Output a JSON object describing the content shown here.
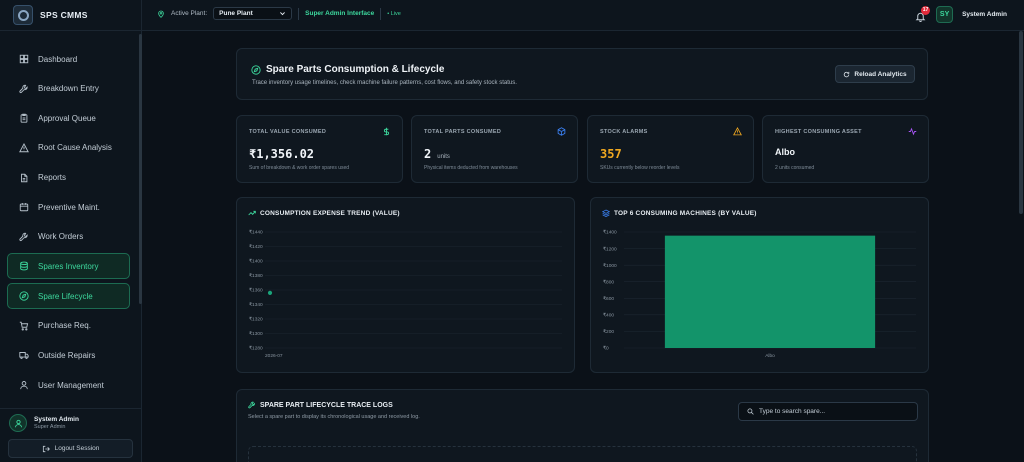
{
  "app": {
    "name": "SPS CMMS"
  },
  "sidebar": {
    "items": [
      {
        "label": "Dashboard",
        "icon": "dashboard-icon",
        "active": false
      },
      {
        "label": "Breakdown Entry",
        "icon": "wrench-icon",
        "active": false
      },
      {
        "label": "Approval Queue",
        "icon": "clipboard-icon",
        "active": false
      },
      {
        "label": "Root Cause Analysis",
        "icon": "warning-triangle-icon",
        "active": false
      },
      {
        "label": "Reports",
        "icon": "file-icon",
        "active": false
      },
      {
        "label": "Preventive Maint.",
        "icon": "calendar-icon",
        "active": false
      },
      {
        "label": "Work Orders",
        "icon": "wrench-icon",
        "active": false
      },
      {
        "label": "Spares Inventory",
        "icon": "database-icon",
        "active": true
      },
      {
        "label": "Spare Lifecycle",
        "icon": "compass-icon",
        "active": true
      },
      {
        "label": "Purchase Req.",
        "icon": "cart-icon",
        "active": false
      },
      {
        "label": "Outside Repairs",
        "icon": "truck-icon",
        "active": false
      },
      {
        "label": "User Management",
        "icon": "user-icon",
        "active": false
      }
    ],
    "user": {
      "name": "System Admin",
      "role": "Super Admin"
    },
    "logout_label": "Logout Session"
  },
  "topbar": {
    "plant_label": "Active Plant:",
    "plant_value": "Pune Plant",
    "interface_label": "Super Admin Interface",
    "live_label": "• Live",
    "notification_count": "17",
    "avatar_initials": "SY",
    "user_name": "System Admin"
  },
  "header": {
    "title": "Spare Parts Consumption & Lifecycle",
    "subtitle": "Trace inventory usage timelines, check machine failure patterns, cost flows, and safety stock status.",
    "reload_label": "Reload Analytics"
  },
  "kpis": [
    {
      "label": "TOTAL VALUE CONSUMED",
      "value": "₹1,356.02",
      "unit": "",
      "note": "Sum of breakdown & work order spares used",
      "icon": "rupee-icon",
      "color": "#3dd99e"
    },
    {
      "label": "TOTAL PARTS CONSUMED",
      "value": "2",
      "unit": "units",
      "note": "Physical items deducted from warehouses",
      "icon": "cube-icon",
      "color": "#3b82f6"
    },
    {
      "label": "STOCK ALARMS",
      "value": "357",
      "unit": "",
      "note": "SKUs currently below reorder levels",
      "icon": "warning-icon",
      "color": "#f0a820"
    },
    {
      "label": "HIGHEST CONSUMING ASSET",
      "value": "Albo",
      "unit": "",
      "note": "2 units consumed",
      "icon": "activity-icon",
      "color": "#a855f7"
    }
  ],
  "chart_data": [
    {
      "type": "line",
      "title": "CONSUMPTION EXPENSE TREND (VALUE)",
      "x": [
        "2026-07"
      ],
      "series": [
        {
          "values": [
            1356.02
          ]
        }
      ],
      "ylim": [
        1280,
        1440
      ],
      "y_ticks": [
        "₹1440",
        "₹1420",
        "₹1400",
        "₹1380",
        "₹1360",
        "₹1340",
        "₹1320",
        "₹1300",
        "₹1280"
      ],
      "color": "#1aa37a",
      "grid": true
    },
    {
      "type": "bar",
      "title": "TOP 6 CONSUMING MACHINES (BY VALUE)",
      "categories": [
        "Albo"
      ],
      "values": [
        1356.02
      ],
      "ylim": [
        0,
        1400
      ],
      "y_ticks": [
        "₹1400",
        "₹1200",
        "₹1000",
        "₹800",
        "₹600",
        "₹400",
        "₹200",
        "₹0"
      ],
      "color": "#13946a",
      "grid": true
    }
  ],
  "trace": {
    "title": "SPARE PART LIFECYCLE TRACE LOGS",
    "subtitle": "Select a spare part to display its chronological usage and received log.",
    "search_placeholder": "Type to search spare..."
  }
}
